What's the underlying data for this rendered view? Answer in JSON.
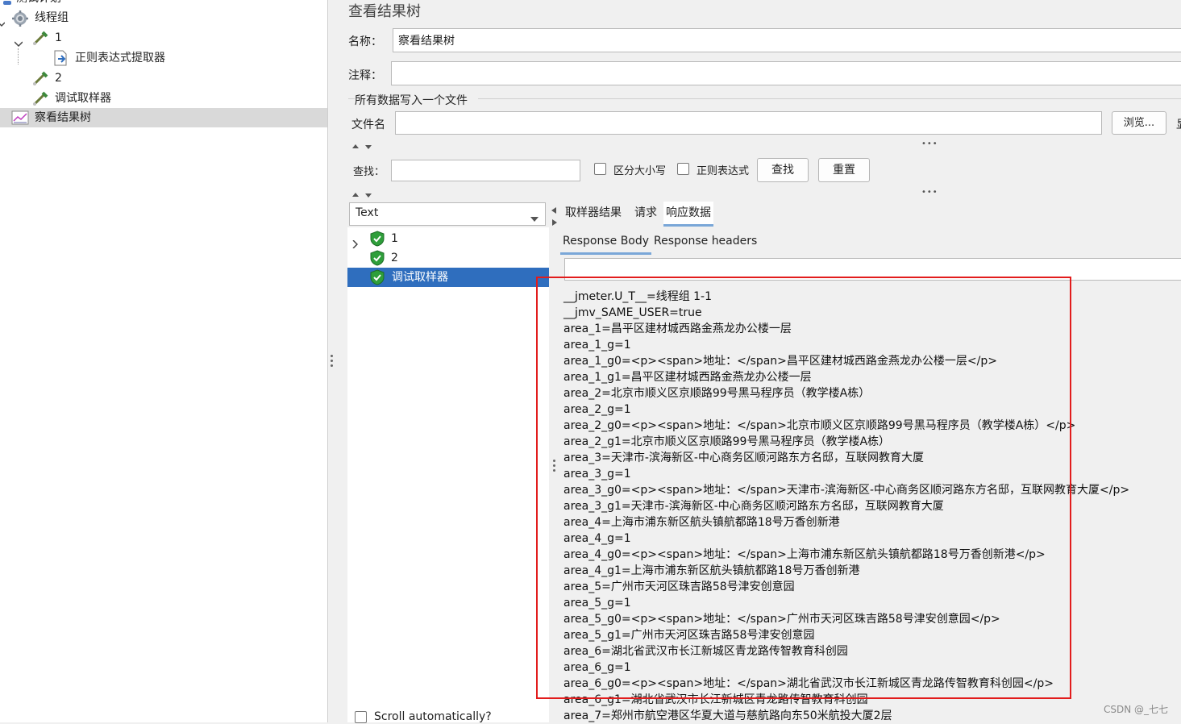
{
  "tree": {
    "items": [
      {
        "label": "测试计划",
        "icon": "test-plan-icon"
      },
      {
        "label": "线程组",
        "icon": "gear-icon"
      },
      {
        "label": "1",
        "icon": "pipette-icon"
      },
      {
        "label": "正则表达式提取器",
        "icon": "extractor-icon"
      },
      {
        "label": "2",
        "icon": "pipette-icon"
      },
      {
        "label": "调试取样器",
        "icon": "pipette-icon"
      },
      {
        "label": "察看结果树",
        "icon": "graph-icon"
      }
    ]
  },
  "panel": {
    "title": "查看结果树",
    "name_label": "名称：",
    "name_value": "察看结果树",
    "comment_label": "注释：",
    "comment_value": "",
    "write_all_label": "所有数据写入一个文件",
    "file_label": "文件名",
    "file_value": "",
    "browse_label": "浏览...",
    "cut_label": "显"
  },
  "search": {
    "label": "查找：",
    "value": "",
    "case_label": "区分大小写",
    "regex_label": "正则表达式",
    "find_button": "查找",
    "reset_button": "重置"
  },
  "renderer": {
    "selected": "Text"
  },
  "results": [
    {
      "label": "1",
      "status": "success"
    },
    {
      "label": "2",
      "status": "success"
    },
    {
      "label": "调试取样器",
      "status": "success"
    }
  ],
  "tabs": [
    "取样器结果",
    "请求",
    "响应数据"
  ],
  "active_tab": "响应数据",
  "subtabs": [
    "Response Body",
    "Response headers"
  ],
  "active_subtab": "Response Body",
  "scroll_auto_label": "Scroll automatically?",
  "response_lines": [
    "__jmeter.U_T__=线程组 1-1",
    "__jmv_SAME_USER=true",
    "area_1=昌平区建材城西路金燕龙办公楼一层",
    "area_1_g=1",
    "area_1_g0=<p><span>地址：</span>昌平区建材城西路金燕龙办公楼一层</p>",
    "area_1_g1=昌平区建材城西路金燕龙办公楼一层",
    "area_2=北京市顺义区京顺路99号黑马程序员（教学楼A栋）",
    "area_2_g=1",
    "area_2_g0=<p><span>地址：</span>北京市顺义区京顺路99号黑马程序员（教学楼A栋）</p>",
    "area_2_g1=北京市顺义区京顺路99号黑马程序员（教学楼A栋）",
    "area_3=天津市-滨海新区-中心商务区顺河路东方名邸，互联网教育大厦",
    "area_3_g=1",
    "area_3_g0=<p><span>地址：</span>天津市-滨海新区-中心商务区顺河路东方名邸，互联网教育大厦</p>",
    "area_3_g1=天津市-滨海新区-中心商务区顺河路东方名邸，互联网教育大厦",
    "area_4=上海市浦东新区航头镇航都路18号万香创新港",
    "area_4_g=1",
    "area_4_g0=<p><span>地址：</span>上海市浦东新区航头镇航都路18号万香创新港</p>",
    "area_4_g1=上海市浦东新区航头镇航都路18号万香创新港",
    "area_5=广州市天河区珠吉路58号津安创意园",
    "area_5_g=1",
    "area_5_g0=<p><span>地址：</span>广州市天河区珠吉路58号津安创意园</p>",
    "area_5_g1=广州市天河区珠吉路58号津安创意园",
    "area_6=湖北省武汉市长江新城区青龙路传智教育科创园",
    "area_6_g=1",
    "area_6_g0=<p><span>地址：</span>湖北省武汉市长江新城区青龙路传智教育科创园</p>",
    "area_6_g1=湖北省武汉市长江新城区青龙路传智教育科创园",
    "area_7=郑州市航空港区华夏大道与慈航路向东50米航投大厦2层"
  ],
  "watermark": "CSDN @_七七",
  "colors": {
    "selection": "#2f6ebe",
    "highlight_box": "#e21c1c",
    "success": "#2e9e3a"
  }
}
